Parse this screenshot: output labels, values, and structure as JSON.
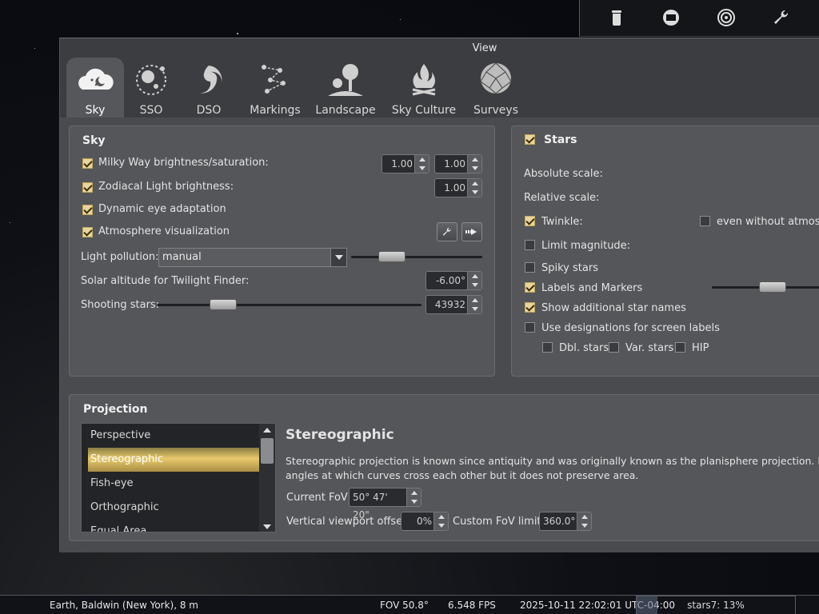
{
  "window": {
    "title": "View"
  },
  "toolbar_icons": [
    "flask-icon",
    "screen-icon",
    "target-icon",
    "wrench-icon"
  ],
  "tabs": [
    {
      "label": "Sky",
      "icon": "sky-cloud-moon-icon",
      "active": true
    },
    {
      "label": "SSO",
      "icon": "solar-system-icon"
    },
    {
      "label": "DSO",
      "icon": "galaxy-icon"
    },
    {
      "label": "Markings",
      "icon": "constellation-icon"
    },
    {
      "label": "Landscape",
      "icon": "landscape-tree-icon"
    },
    {
      "label": "Sky Culture",
      "icon": "campfire-icon"
    },
    {
      "label": "Surveys",
      "icon": "geodesic-sphere-icon"
    }
  ],
  "sky": {
    "title": "Sky",
    "milky_way": {
      "label": "Milky Way brightness/saturation:",
      "checked": true,
      "brightness": "1.00",
      "saturation": "1.00"
    },
    "zodiacal": {
      "label": "Zodiacal Light brightness:",
      "checked": true,
      "value": "1.00"
    },
    "dynamic_eye": {
      "label": "Dynamic eye adaptation",
      "checked": true
    },
    "atmosphere": {
      "label": "Atmosphere visualization",
      "checked": true
    },
    "light_pollution": {
      "label": "Light pollution:",
      "value": "manual",
      "level": 0.26
    },
    "solar_altitude": {
      "label": "Solar altitude for Twilight Finder:",
      "value": "-6.00°"
    },
    "shooting_stars": {
      "label": "Shooting stars:",
      "value": "43932",
      "level": 0.22
    }
  },
  "stars": {
    "title": "Stars",
    "checked": true,
    "absolute_scale": "Absolute scale:",
    "relative_scale": "Relative scale:",
    "twinkle": {
      "label": "Twinkle:",
      "checked": true
    },
    "without_atmosphere": {
      "label": "even without atmosp",
      "checked": false
    },
    "limit_magnitude": {
      "label": "Limit magnitude:",
      "checked": false
    },
    "spiky_stars": {
      "label": "Spiky stars",
      "checked": false
    },
    "labels_markers": {
      "label": "Labels and Markers",
      "checked": true
    },
    "additional_names": {
      "label": "Show additional star names",
      "checked": true
    },
    "designations": {
      "label": "Use designations for screen labels",
      "checked": false
    },
    "dbl_stars": {
      "label": "Dbl. stars",
      "checked": false
    },
    "var_stars": {
      "label": "Var. stars",
      "checked": false
    },
    "hip": {
      "label": "HIP",
      "checked": false
    }
  },
  "projection": {
    "title": "Projection",
    "items": [
      "Perspective",
      "Stereographic",
      "Fish-eye",
      "Orthographic",
      "Equal Area"
    ],
    "selected": "Stereographic",
    "heading": "Stereographic",
    "description_1": "Stereographic projection is known since antiquity and was originally known as the planisphere projection. It pres",
    "description_2": "angles at which curves cross each other but it does not preserve area.",
    "current_fov_label": "Current FoV",
    "current_fov": "50° 47' 20\"",
    "viewport_offset_label": "Vertical viewport offset",
    "viewport_offset": "0%",
    "custom_fov_label": "Custom FoV limit",
    "custom_fov": "360.0°"
  },
  "statusbar": {
    "location": "Earth, Baldwin (New York), 8 m",
    "fov": "FOV 50.8°",
    "fps": "6.548 FPS",
    "datetime": "2025-10-11 22:02:01 UTC-04:00",
    "progress_text": "stars7: 13%",
    "progress": 0.13
  }
}
